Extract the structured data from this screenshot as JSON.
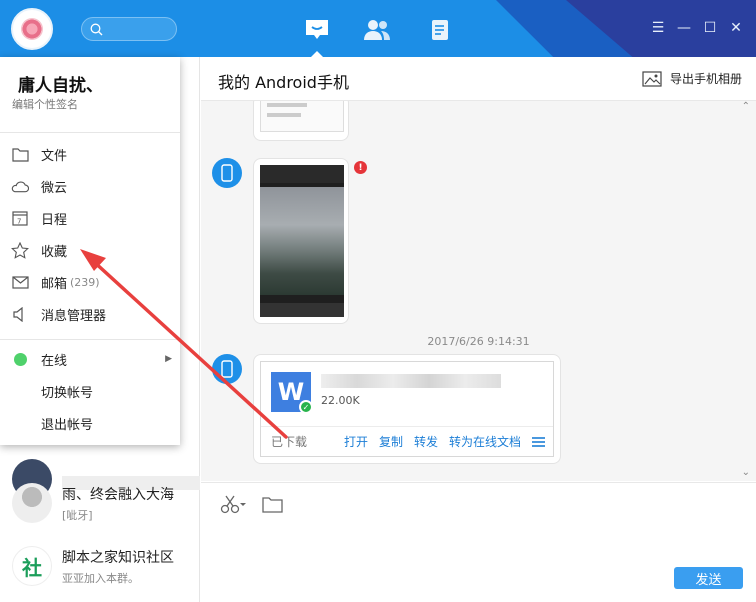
{
  "search": {
    "placeholder": ""
  },
  "nav_tabs": [
    {
      "name": "messages-tab",
      "icon": "chat-icon",
      "active": true
    },
    {
      "name": "contacts-tab",
      "icon": "contacts-icon",
      "active": false
    },
    {
      "name": "apps-tab",
      "icon": "documents-icon",
      "active": false
    }
  ],
  "window_controls": {
    "menu": "☰",
    "minimize": "—",
    "maximize": "☐",
    "close": "✕"
  },
  "profile": {
    "username": "庸人自扰、",
    "signature": "编辑个性签名"
  },
  "menu": {
    "items": [
      {
        "label": "文件",
        "icon": "folder-icon"
      },
      {
        "label": "微云",
        "icon": "cloud-icon"
      },
      {
        "label": "日程",
        "icon": "calendar-icon"
      },
      {
        "label": "收藏",
        "icon": "star-icon"
      },
      {
        "label": "邮箱",
        "count": "(239)",
        "icon": "mail-icon"
      },
      {
        "label": "消息管理器",
        "icon": "speaker-icon"
      }
    ],
    "status": {
      "label": "在线",
      "color": "#4fd16b"
    },
    "switch_account": "切换帐号",
    "logout": "退出帐号"
  },
  "contacts": [
    {
      "name": "雨、终会融入大海",
      "sub": "[呲牙]"
    },
    {
      "name": "脚本之家知识社区",
      "sub": "亚亚加入本群。"
    }
  ],
  "chat": {
    "title": "我的 Android手机",
    "export_label": "导出手机相册",
    "timestamp": "2017/6/26 9:14:31",
    "file": {
      "icon_letter": "W",
      "size": "22.00K",
      "status": "已下载",
      "actions": [
        "打开",
        "复制",
        "转发",
        "转为在线文档"
      ]
    },
    "warn_mark": "!"
  },
  "send_label": "发送",
  "colors": {
    "accent": "#1c8ee6",
    "link": "#1c7ed6",
    "annotation": "#e8403e"
  }
}
